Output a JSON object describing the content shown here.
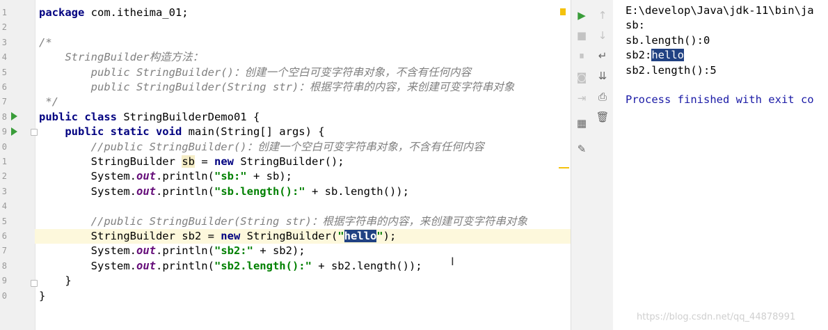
{
  "editor": {
    "line_numbers": [
      "1",
      "2",
      "3",
      "4",
      "5",
      "6",
      "7",
      "8",
      "9",
      "0",
      "1",
      "2",
      "3",
      "4",
      "5",
      "6",
      "7",
      "8",
      "9",
      "0"
    ],
    "code": {
      "l1_kw": "package",
      "l1_rest": " com.itheima_01;",
      "l3": "/*",
      "l4": "    StringBuilder构造方法：",
      "l5": "        public StringBuilder()：创建一个空白可变字符串对象，不含有任何内容",
      "l6": "        public StringBuilder(String str)：根据字符串的内容，来创建可变字符串对象",
      "l7": " */",
      "l8_kw": "public class",
      "l8_rest": " StringBuilderDemo01 {",
      "l9_kw": "    public static void",
      "l9_rest": " main(String[] args) {",
      "l10": "        //public StringBuilder()：创建一个空白可变字符串对象，不含有任何内容",
      "l11_a": "        StringBuilder ",
      "l11_var": "sb",
      "l11_b": " = ",
      "l11_kw": "new",
      "l11_c": " StringBuilder();",
      "sys": "        System.",
      "out": "out",
      "println": ".println(",
      "l12_str": "\"sb:\"",
      "l12_rest": " + sb);",
      "l13_str": "\"sb.length():\"",
      "l13_rest": " + sb.length());",
      "l15": "        //public StringBuilder(String str)：根据字符串的内容，来创建可变字符串对象",
      "l16_a": "        StringBuilder sb2 = ",
      "l16_kw": "new",
      "l16_b": " StringBuilder(",
      "l16_q1": "\"",
      "l16_sel": "hello",
      "l16_q2": "\"",
      "l16_c": ");",
      "l17_str": "\"sb2:\"",
      "l17_rest": " + sb2);",
      "l18_str": "\"sb2.length():\"",
      "l18_rest": " + sb2.length());",
      "l19": "    }",
      "l20": "}"
    }
  },
  "toolbar": {
    "buttons": [
      "play-icon",
      "stop-icon",
      "pause-icon",
      "camera-icon",
      "exit-icon",
      "layout-icon",
      "pin-icon",
      "up-arrow-icon",
      "down-arrow-icon",
      "soft-wrap-icon",
      "scroll-to-end-icon",
      "print-icon",
      "trash-icon"
    ]
  },
  "console": {
    "line1": "E:\\develop\\Java\\jdk-11\\bin\\ja",
    "line2": "sb:",
    "line3": "sb.length():0",
    "line4_a": "sb2:",
    "line4_sel": "hello",
    "line5": "sb2.length():5",
    "line7": "Process finished with exit co"
  },
  "watermark": "https://blog.csdn.net/qq_44878991",
  "colors": {
    "keyword": "#000080",
    "string": "#008000",
    "comment": "#808080",
    "static_field": "#660e7a",
    "selection": "#214283",
    "run_green": "#3a9d3a",
    "console_blue": "#1a1aa6"
  }
}
